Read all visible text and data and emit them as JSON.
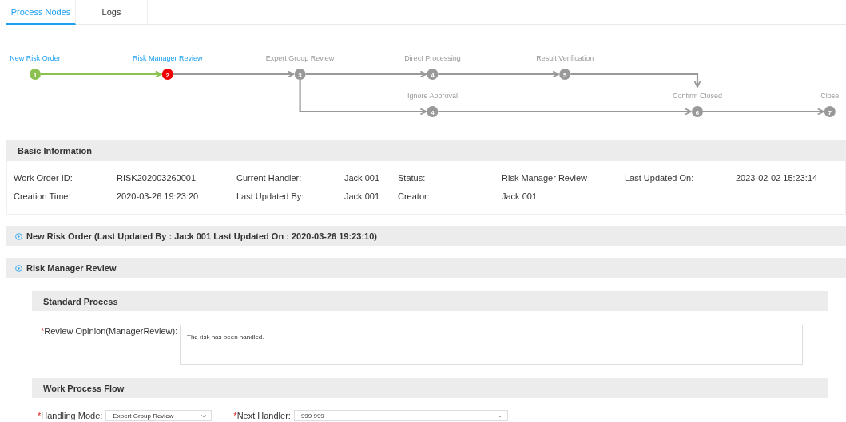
{
  "tabs": [
    {
      "label": "Process Nodes",
      "selected": true
    },
    {
      "label": "Logs",
      "selected": false
    }
  ],
  "flow": {
    "nodes": [
      {
        "number": "1",
        "label": "New Risk Order",
        "done": true,
        "current": false
      },
      {
        "number": "2",
        "label": "Risk Manager Review",
        "done": false,
        "current": true
      },
      {
        "number": "3",
        "label": "Expert Group Review",
        "done": false,
        "current": false
      },
      {
        "number": "4",
        "label": "Direct Processing",
        "done": false,
        "current": false
      },
      {
        "number": "5",
        "label": "Result Verification",
        "done": false,
        "current": false
      },
      {
        "number": "4",
        "label": "Ignore Approval",
        "done": false,
        "current": false
      },
      {
        "number": "6",
        "label": "Confirm Closed",
        "done": false,
        "current": false
      },
      {
        "number": "7",
        "label": "Close",
        "done": false,
        "current": false
      }
    ]
  },
  "basic_information": {
    "title": "Basic Information",
    "fields": [
      {
        "label": "Work Order ID:",
        "value": "RISK202003260001"
      },
      {
        "label": "Current Handler:",
        "value": "Jack 001"
      },
      {
        "label": "Status:",
        "value": "Risk Manager Review"
      },
      {
        "label": "Last Updated On:",
        "value": "2023-02-02 15:23:14"
      },
      {
        "label": "Creation Time:",
        "value": "2020-03-26 19:23:20"
      },
      {
        "label": "Last Updated By:",
        "value": "Jack 001"
      },
      {
        "label": "Creator:",
        "value": "Jack 001"
      }
    ]
  },
  "sections": [
    {
      "title": "New Risk Order (Last Updated By : Jack 001 Last Updated On : 2020-03-26 19:23:10)",
      "expanded": false
    },
    {
      "title": "Risk Manager Review",
      "expanded": true
    }
  ],
  "review": {
    "standard_process": {
      "title": "Standard Process",
      "label": "Review Opinion(ManagerReview):",
      "required_mark": "*",
      "value": "The risk has been handled."
    },
    "work_process_flow": {
      "title": "Work Process Flow",
      "fields": [
        {
          "label": "Handling Mode:",
          "required_mark": "*",
          "value": "Expert Group Review"
        },
        {
          "label": "Next Handler:",
          "required_mark": "*",
          "value": "999 999"
        }
      ]
    }
  }
}
